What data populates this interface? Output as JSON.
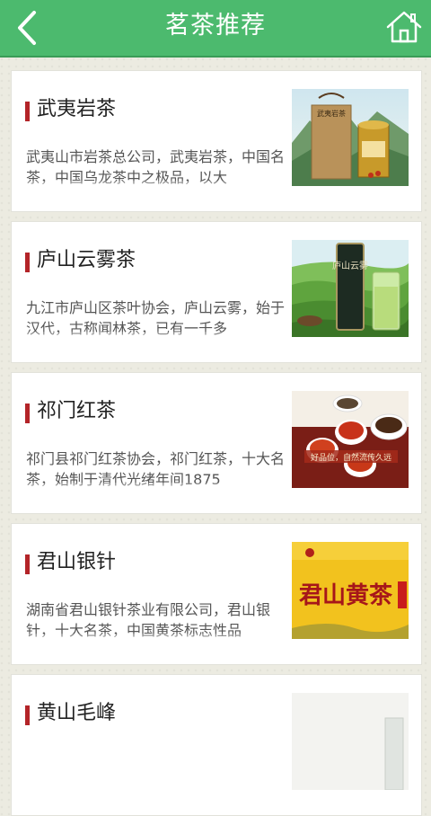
{
  "header": {
    "title": "茗茶推荐",
    "back_icon": "chevron-left-icon",
    "home_icon": "home-icon",
    "bar_color": "#4cba6e"
  },
  "items": [
    {
      "title": "武夷岩茶",
      "desc": "武夷山市岩茶总公司，武夷岩茶，中国名茶，中国乌龙茶中之极品，以大",
      "image": "wuyi-yancha-tea-packaging",
      "image_text": "武夷岩茶"
    },
    {
      "title": "庐山云雾茶",
      "desc": "九江市庐山区茶叶协会，庐山云雾，始于汉代，古称闻林茶，已有一千多",
      "image": "lushan-yunwu-tea-plantation",
      "image_text": "庐山云雾"
    },
    {
      "title": "祁门红茶",
      "desc": "祁门县祁门红茶协会，祁门红茶，十大名茶，始制于清代光绪年间1875",
      "image": "keemun-black-tea-cups",
      "image_text": "好品位，自然流传久远"
    },
    {
      "title": "君山银针",
      "desc": "湖南省君山银针茶业有限公司，君山银针，十大名茶，中国黄茶标志性品",
      "image": "junshan-huangcha-banner",
      "image_text": "君山黄茶"
    },
    {
      "title": "黄山毛峰",
      "desc": "",
      "image": "huangshan-maofeng-tea",
      "image_text": ""
    }
  ]
}
